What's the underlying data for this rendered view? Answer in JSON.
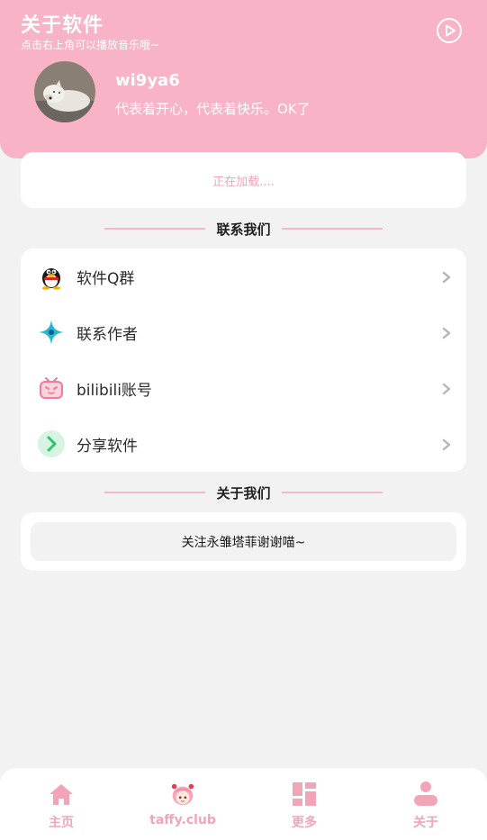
{
  "header": {
    "title": "关于软件",
    "subtitle": "点击右上角可以播放音乐哦~",
    "username": "wi9ya6",
    "motto": "代表着开心，代表着快乐。OK了"
  },
  "notice": {
    "text": "正在加载...."
  },
  "contact_section": {
    "title": "联系我们",
    "items": [
      {
        "label": "软件Q群",
        "icon": "qq-penguin-icon"
      },
      {
        "label": "联系作者",
        "icon": "sparkle-star-icon"
      },
      {
        "label": "bilibili账号",
        "icon": "bilibili-tv-icon"
      },
      {
        "label": "分享软件",
        "icon": "share-arrow-icon"
      }
    ]
  },
  "about_section": {
    "title": "关于我们",
    "text": "关注永雏塔菲谢谢喵~"
  },
  "tabbar": {
    "items": [
      {
        "label": "主页",
        "icon": "home-icon"
      },
      {
        "label": "taffy.club",
        "icon": "taffy-avatar-icon"
      },
      {
        "label": "更多",
        "icon": "grid-layout-icon"
      },
      {
        "label": "关于",
        "icon": "user-icon"
      }
    ]
  },
  "colors": {
    "accent": "#f8b4c6",
    "accent_text": "#f3a5b8",
    "background": "#f1f2f1"
  }
}
